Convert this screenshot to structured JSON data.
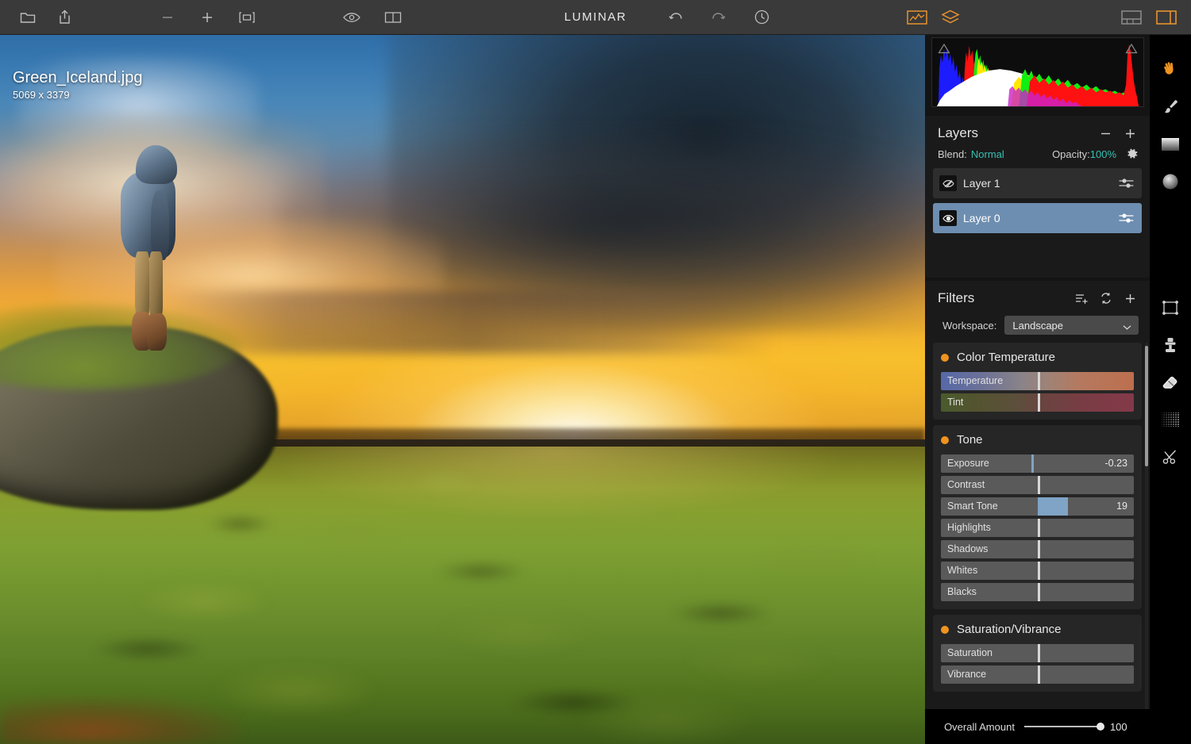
{
  "app": {
    "title": "LUMINAR"
  },
  "toolbar": {
    "left": [
      {
        "name": "open-folder-icon",
        "label": "Open"
      },
      {
        "name": "share-export-icon",
        "label": "Share"
      }
    ],
    "zoom": [
      {
        "name": "zoom-out-icon",
        "label": "Zoom Out"
      },
      {
        "name": "zoom-in-icon",
        "label": "Zoom In"
      },
      {
        "name": "fit-to-screen-icon",
        "label": "Fit to Screen"
      }
    ],
    "view": [
      {
        "name": "preview-eye-icon",
        "label": "Quick Preview"
      },
      {
        "name": "compare-split-icon",
        "label": "Compare"
      }
    ],
    "history": [
      {
        "name": "undo-icon",
        "label": "Undo"
      },
      {
        "name": "redo-icon",
        "label": "Redo"
      },
      {
        "name": "history-clock-icon",
        "label": "History"
      }
    ],
    "panels": [
      {
        "name": "histogram-toggle-icon",
        "label": "Histogram",
        "active": true
      },
      {
        "name": "layers-toggle-icon",
        "label": "Layers",
        "active": true
      }
    ],
    "layout": [
      {
        "name": "filmstrip-view-icon",
        "label": "Filmstrip",
        "active": false
      },
      {
        "name": "side-panel-view-icon",
        "label": "Side Panel",
        "active": true
      }
    ]
  },
  "image": {
    "filename": "Green_Iceland.jpg",
    "dimensions": "5069 x 3379"
  },
  "histogram": {
    "shadow_clip_label": "Shadow Clipping",
    "highlight_clip_label": "Highlight Clipping"
  },
  "layers_panel": {
    "title": "Layers",
    "remove_label": "Remove Layer",
    "add_label": "Add Layer",
    "blend_label": "Blend:",
    "blend_value": "Normal",
    "opacity_label": "Opacity:",
    "opacity_value": "100%",
    "settings_label": "Layer Settings",
    "accent_color": "#36c0b0",
    "items": [
      {
        "name": "Layer 1",
        "visible": false,
        "selected": false
      },
      {
        "name": "Layer 0",
        "visible": true,
        "selected": true
      }
    ]
  },
  "filters_panel": {
    "title": "Filters",
    "header_icons": [
      {
        "name": "add-filter-list-icon",
        "label": "Add Filters"
      },
      {
        "name": "sync-filters-icon",
        "label": "Reset Filters"
      },
      {
        "name": "add-icon",
        "label": "Add"
      }
    ],
    "workspace_label": "Workspace:",
    "workspace_value": "Landscape",
    "accent_color": "#f0931f",
    "groups": [
      {
        "title": "Color Temperature",
        "sliders": [
          {
            "label": "Temperature",
            "value": "",
            "position": 50,
            "style": "temp"
          },
          {
            "label": "Tint",
            "value": "",
            "position": 50,
            "style": "tint"
          }
        ]
      },
      {
        "title": "Tone",
        "sliders": [
          {
            "label": "Exposure",
            "value": "-0.23",
            "position": 47,
            "style": "blue-mark"
          },
          {
            "label": "Contrast",
            "value": "",
            "position": 50,
            "style": "plain"
          },
          {
            "label": "Smart Tone",
            "value": "19",
            "position": 50,
            "style": "fill",
            "fill_to": 66
          },
          {
            "label": "Highlights",
            "value": "",
            "position": 50,
            "style": "plain"
          },
          {
            "label": "Shadows",
            "value": "",
            "position": 50,
            "style": "plain"
          },
          {
            "label": "Whites",
            "value": "",
            "position": 50,
            "style": "plain"
          },
          {
            "label": "Blacks",
            "value": "",
            "position": 50,
            "style": "plain"
          }
        ]
      },
      {
        "title": "Saturation/Vibrance",
        "sliders": [
          {
            "label": "Saturation",
            "value": "",
            "position": 50,
            "style": "plain"
          },
          {
            "label": "Vibrance",
            "value": "",
            "position": 50,
            "style": "plain"
          }
        ]
      }
    ]
  },
  "status_bar": {
    "label": "Overall Amount",
    "value": "100"
  },
  "tools": [
    {
      "name": "hand-tool-icon",
      "label": "Pan",
      "active": true
    },
    {
      "name": "brush-tool-icon",
      "label": "Brush",
      "active": false
    },
    {
      "name": "gradient-mask-icon",
      "label": "Gradient Mask",
      "active": false
    },
    {
      "name": "radial-mask-icon",
      "label": "Radial Mask",
      "active": false
    },
    {
      "name": "crop-tool-icon",
      "label": "Crop",
      "active": false
    },
    {
      "name": "clone-stamp-icon",
      "label": "Clone & Stamp",
      "active": false
    },
    {
      "name": "eraser-tool-icon",
      "label": "Erase",
      "active": false
    },
    {
      "name": "denoise-texture-icon",
      "label": "Denoise",
      "active": false
    },
    {
      "name": "scissors-cut-icon",
      "label": "Cut",
      "active": false
    }
  ]
}
